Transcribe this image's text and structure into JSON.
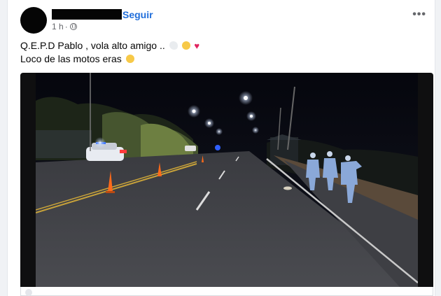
{
  "post": {
    "follow_label": "Seguir",
    "time": "1 h",
    "time_sep": "·",
    "line1": "Q.E.P.D Pablo , vola alto amigo ..",
    "line2": "Loco de las motos eras",
    "more_label": "•••",
    "line1_emojis": [
      "dove-emoji",
      "sad-face-emoji",
      "red-heart-emoji"
    ],
    "line2_emojis": [
      "sad-face-emoji"
    ]
  },
  "colors": {
    "follow": "#216fdb",
    "meta": "#65676b",
    "text": "#050505",
    "page_bg": "#f0f2f5",
    "card_bg": "#ffffff"
  }
}
